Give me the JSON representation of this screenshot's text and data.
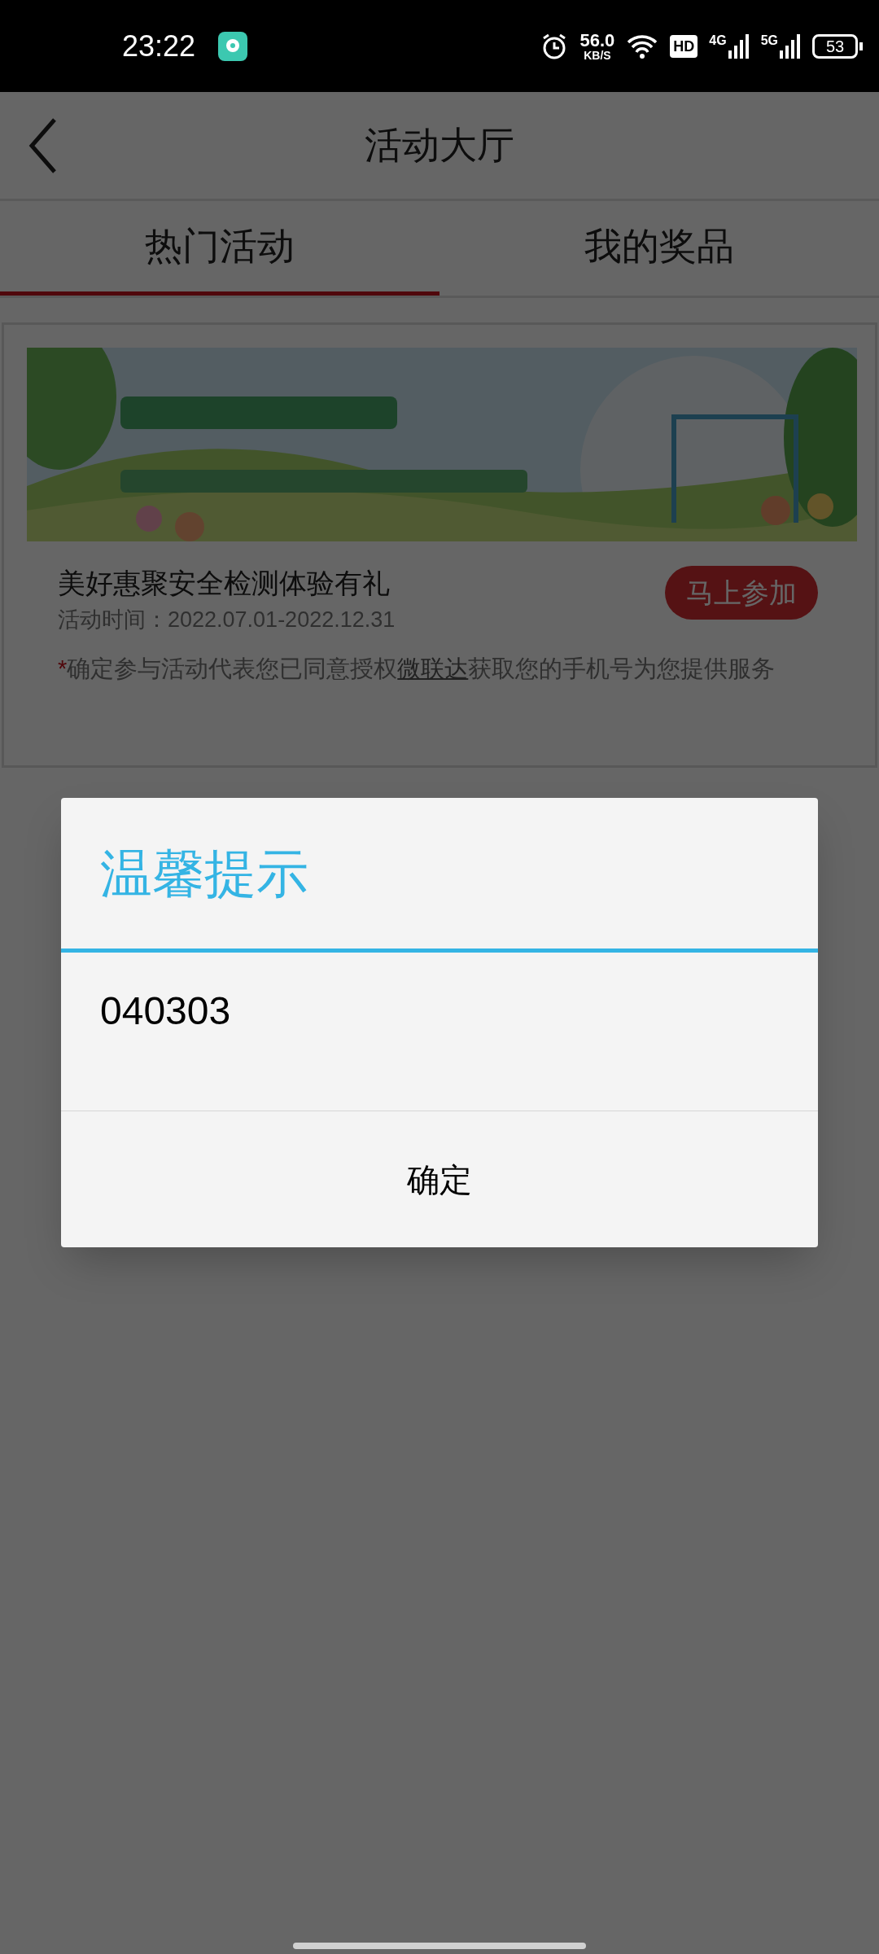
{
  "status_bar": {
    "time": "23:22",
    "net_speed": "56.0",
    "net_unit": "KB/S",
    "hd": "HD",
    "signals": [
      "4G",
      "5G"
    ],
    "battery": "53"
  },
  "header": {
    "title": "活动大厅"
  },
  "tabs": [
    {
      "label": "热门活动",
      "selected": true
    },
    {
      "label": "我的奖品",
      "selected": false
    }
  ],
  "activity": {
    "title": "美好惠聚安全检测体验有礼",
    "period": "活动时间：2022.07.01-2022.12.31",
    "join_button": "马上参加",
    "notice": {
      "mark": "*",
      "before": "确定参与活动代表您已同意授权",
      "link": "微联达",
      "after": "获取您的手机号为您提供服务"
    }
  },
  "dialog": {
    "title": "温馨提示",
    "message": "040303",
    "button": "确定"
  }
}
